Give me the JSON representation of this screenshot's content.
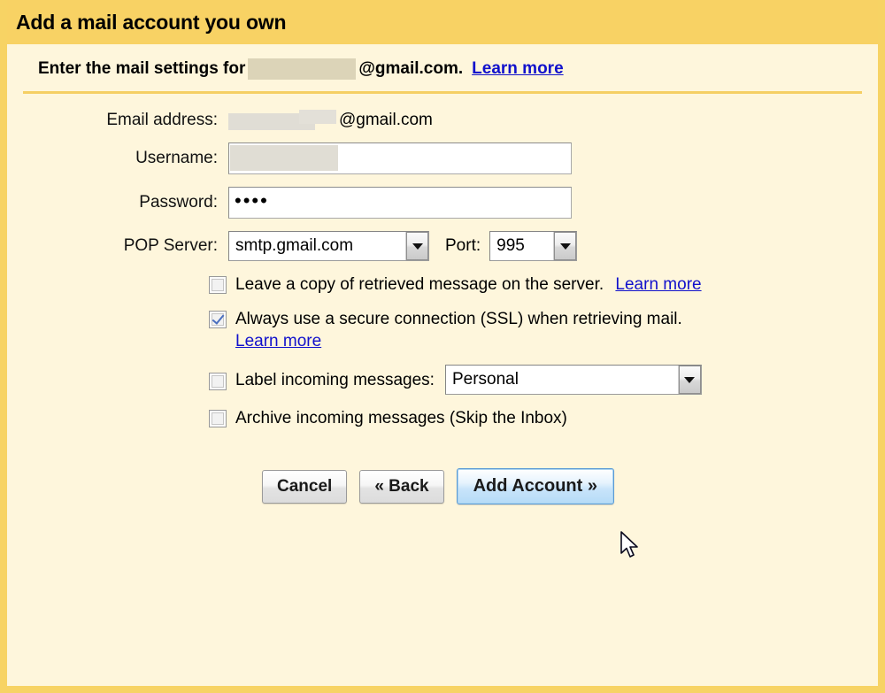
{
  "dialog": {
    "title": "Add a mail account you own",
    "header_bg": "#f8d264",
    "body_bg": "#fef6dc",
    "border_color": "#f7d364"
  },
  "subtitle": {
    "prefix": "Enter the mail settings for",
    "redacted_placeholder": "",
    "domain_suffix": "@gmail.com.",
    "learn_more": "Learn more"
  },
  "form": {
    "email": {
      "label": "Email address:",
      "redacted_value": "",
      "domain": "@gmail.com"
    },
    "username": {
      "label": "Username:",
      "value": ""
    },
    "password": {
      "label": "Password:",
      "value": "••••"
    },
    "pop_server": {
      "label": "POP Server:",
      "value": "smtp.gmail.com",
      "arrow_icon": "chevron-down-icon"
    },
    "port": {
      "label": "Port:",
      "value": "995",
      "arrow_icon": "chevron-down-icon"
    }
  },
  "options": {
    "leave_copy": {
      "label": "Leave a copy of retrieved message on the server.",
      "learn_more": "Learn more",
      "checked": false
    },
    "ssl": {
      "label": "Always use a secure connection (SSL) when retrieving mail.",
      "learn_more": "Learn more",
      "checked": true
    },
    "label_incoming": {
      "label": "Label incoming messages:",
      "checked": false,
      "select_value": "Personal",
      "arrow_icon": "chevron-down-icon"
    },
    "archive_incoming": {
      "label": "Archive incoming messages (Skip the Inbox)",
      "checked": false
    }
  },
  "buttons": {
    "cancel": "Cancel",
    "back": "« Back",
    "add_account": "Add Account »"
  },
  "colors": {
    "link": "#1111cc",
    "primary_button_border": "#5b9ad5",
    "checkmark": "#4a6fbf",
    "redaction": "#dcd4b8"
  }
}
